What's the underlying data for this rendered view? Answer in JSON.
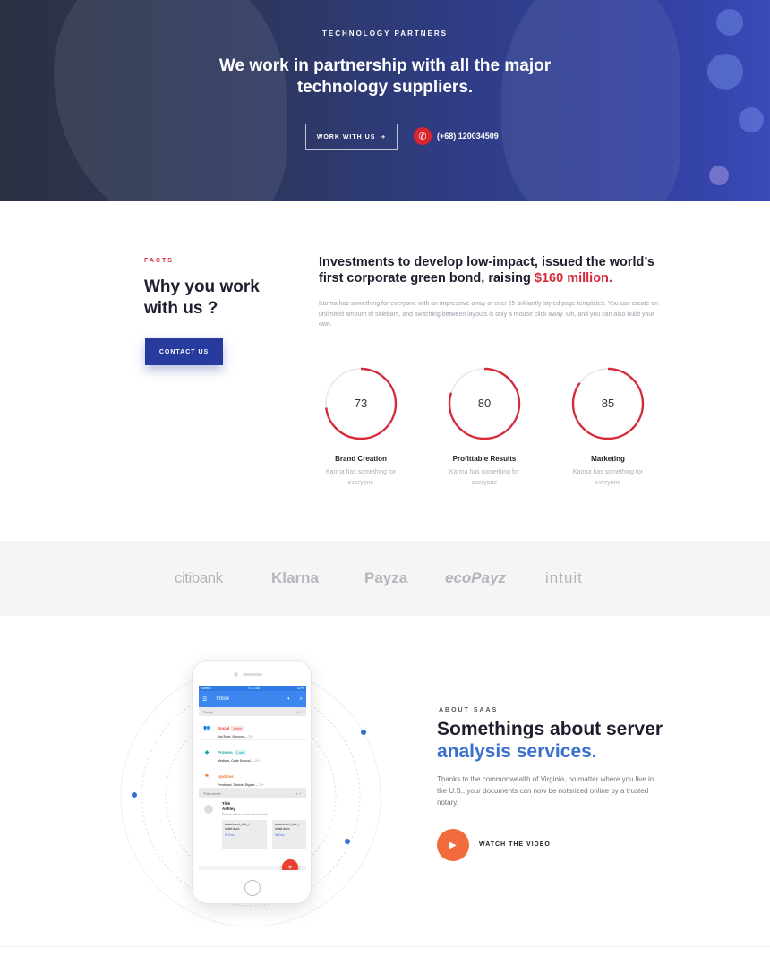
{
  "hero": {
    "eyebrow": "TECHNOLOGY PARTNERS",
    "title": "We work in partnership with all the major technology suppliers.",
    "work_button": "WORK WITH US",
    "work_button_arrow": "➔",
    "phone": "(+68) 120034509",
    "phone_icon": "phone-icon"
  },
  "facts": {
    "eyebrow": "FACTS",
    "title": "Why you work with us ?",
    "contact_button": "CONTACT US",
    "headline_part1": "Investments to develop low-impact, issued the world’s first corporate green bond, raising ",
    "headline_accent": "$160 million.",
    "description": "Karma has something for everyone with an impressive array of over 25 brilliantly-styled page templates. You can create an unlimited amount of sidebars, and switching between layouts is only a mouse click away. Oh, and you can also build your own.",
    "stats": [
      {
        "value": "73",
        "percent": 73,
        "label": "Brand Creation",
        "sub": "Karma has something for everyone"
      },
      {
        "value": "80",
        "percent": 80,
        "label": "Profittable Results",
        "sub": "Karma has something for everyone"
      },
      {
        "value": "85",
        "percent": 85,
        "label": "Marketing",
        "sub": "Karma has something for everyone"
      }
    ],
    "accent_color": "#d62a3a"
  },
  "logos": [
    "citibank",
    "Klarna",
    "Payza",
    "ecoPayz",
    "intuit"
  ],
  "app_mock": {
    "status_left": "Sketch",
    "status_time": "9:41 AM",
    "status_right": "42%",
    "appbar_title": "Inbox",
    "today_label": "Today",
    "rows": [
      {
        "title": "Social",
        "tag": "1 new",
        "sub": "YouTube, Guncey ...",
        "count": "25+",
        "color": "#e53935",
        "tag_bg": "#fde0e0"
      },
      {
        "title": "Promos",
        "tag": "1 new",
        "sub": "Medium, Code School ...",
        "count": "25+",
        "color": "#1a9fa8",
        "tag_bg": "#d8f2f3"
      },
      {
        "title": "Updates",
        "tag": "",
        "sub": "Feedspot, Todoist Digest ...",
        "count": "25+",
        "color": "#f0793a",
        "tag_bg": ""
      }
    ],
    "month_label": "This month",
    "mail_title": "Title",
    "mail_sender": "Ashley",
    "mail_hint": "Please check out the attachment",
    "attach1_name": "attachment_title_l hoisit.docx",
    "attach1_type": "W Doc",
    "attach2_name": "attachment_title_l hoisit.docx",
    "attach2_type": "W Doc",
    "fab_symbol": "+"
  },
  "about": {
    "eyebrow": "ABOUT SAAS",
    "title_line1": "Somethings about server",
    "title_line2": "analysis services.",
    "description": "Thanks to the commonwealth of Virginia, no matter where you live in the U.S., your documents can now be notarized online by a trusted notary.",
    "watch_label": "WATCH THE VIDEO",
    "play_icon": "play-icon",
    "accent_color": "#f26b3d"
  }
}
